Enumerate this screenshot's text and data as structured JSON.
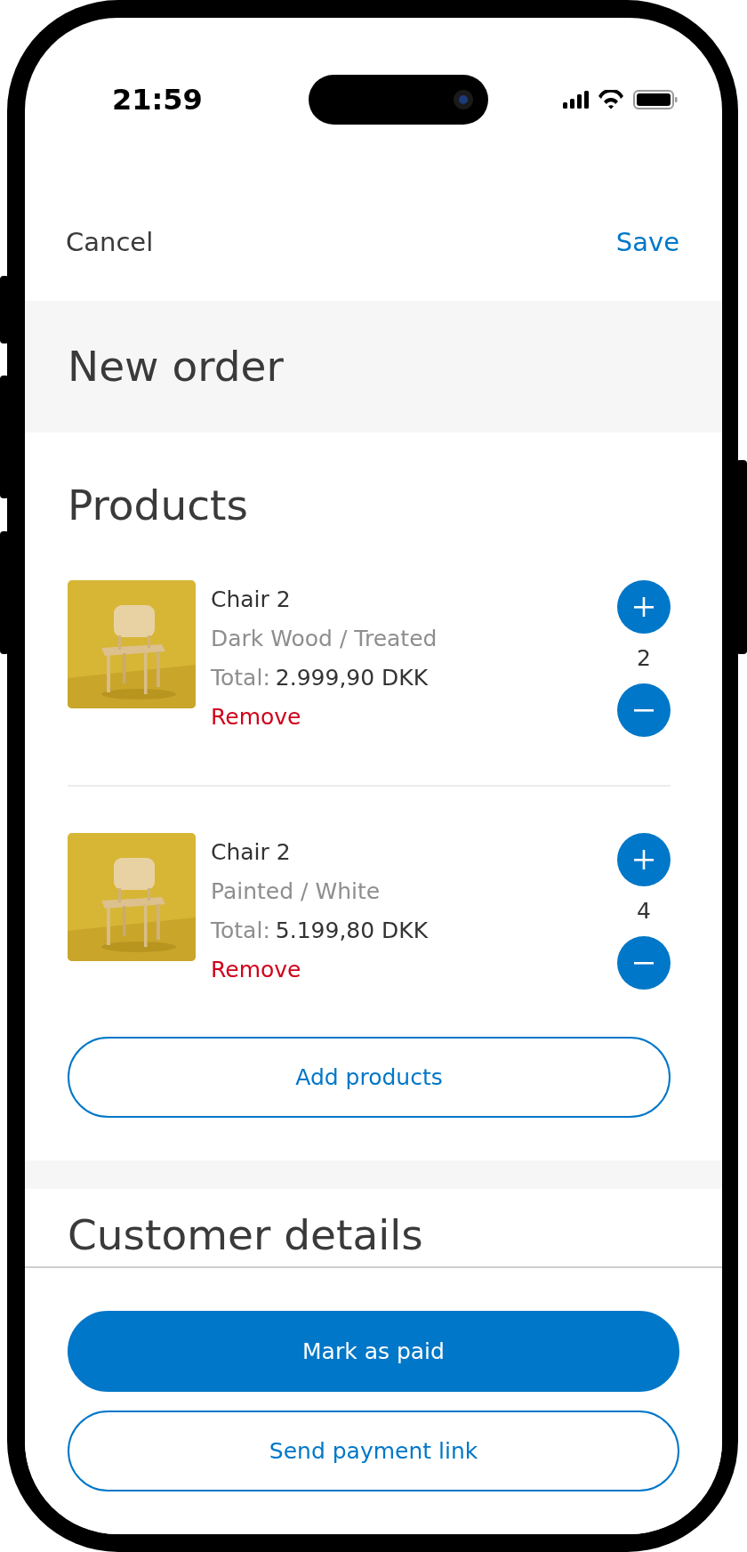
{
  "status_bar": {
    "time": "21:59"
  },
  "nav": {
    "cancel": "Cancel",
    "save": "Save"
  },
  "title": "New order",
  "products_section": {
    "heading": "Products",
    "items": [
      {
        "name": "Chair 2",
        "variant": "Dark Wood / Treated",
        "total_label": "Total:",
        "total": "2.999,90 DKK",
        "remove": "Remove",
        "quantity": "2"
      },
      {
        "name": "Chair 2",
        "variant": "Painted / White",
        "total_label": "Total:",
        "total": "5.199,80 DKK",
        "remove": "Remove",
        "quantity": "4"
      }
    ],
    "add_button": "Add products"
  },
  "customer_section": {
    "heading": "Customer details"
  },
  "actions": [
    {
      "label": "Mark as paid",
      "kind": "primary"
    },
    {
      "label": "Send payment link",
      "kind": "outline"
    }
  ]
}
